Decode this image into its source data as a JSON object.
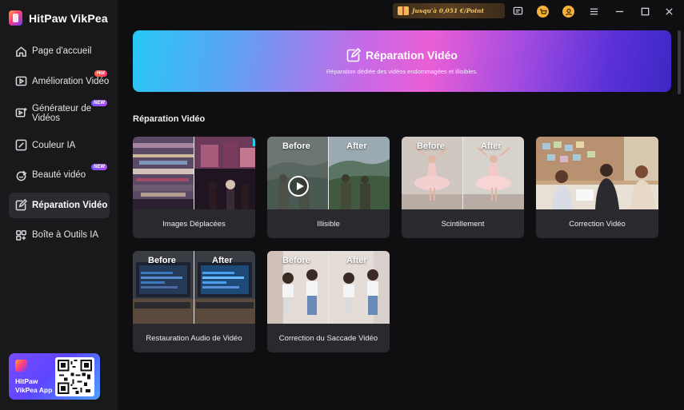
{
  "app": {
    "name": "HitPaw VikPea"
  },
  "sidebar": {
    "items": [
      {
        "label": "Page d'accueil",
        "icon": "home-icon",
        "badge": ""
      },
      {
        "label": "Amélioration Vidéo",
        "icon": "video-enhance-icon",
        "badge": "Hot"
      },
      {
        "label": "Générateur de Vidéos",
        "icon": "video-generator-icon",
        "badge": "NEW"
      },
      {
        "label": "Couleur IA",
        "icon": "color-icon",
        "badge": ""
      },
      {
        "label": "Beauté vidéo",
        "icon": "beauty-icon",
        "badge": "NEW"
      },
      {
        "label": "Réparation Vidéo",
        "icon": "repair-icon",
        "badge": "",
        "active": true
      },
      {
        "label": "Boîte à Outils IA",
        "icon": "toolbox-icon",
        "badge": ""
      }
    ],
    "app_card": {
      "line1": "HitPaw",
      "line2": "VikPea App"
    }
  },
  "topbar": {
    "promo": "Jusqu'à 0,051 €/Point",
    "icons": [
      "message-icon",
      "cart-icon",
      "account-icon",
      "menu-icon",
      "minimize-icon",
      "maximize-icon",
      "close-icon"
    ]
  },
  "hero": {
    "title": "Réparation Vidéo",
    "description": "Réparation dédiée des vidéos endommagées et illisibles."
  },
  "section": {
    "title": "Réparation Vidéo"
  },
  "cards": [
    {
      "caption": "Images Déplacées",
      "before": "",
      "after": ""
    },
    {
      "caption": "Illisible",
      "before": "Before",
      "after": "After"
    },
    {
      "caption": "Scintillement",
      "before": "Before",
      "after": "After"
    },
    {
      "caption": "Correction Vidéo",
      "before": "",
      "after": ""
    },
    {
      "caption": "Restauration Audio de Vidéo",
      "before": "Before",
      "after": "After"
    },
    {
      "caption": "Correction du Saccade Vidéo",
      "before": "Before",
      "after": "After"
    }
  ],
  "colors": {
    "accent": "#5a31d8",
    "sidebar_bg": "#19191c",
    "main_bg": "#0f0f12",
    "card_bg": "#2a2a2e"
  }
}
